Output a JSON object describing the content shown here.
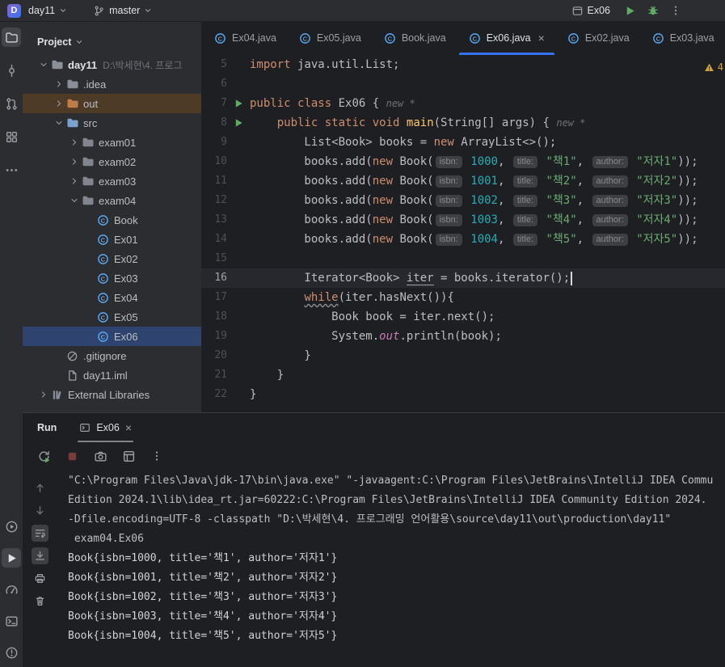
{
  "topbar": {
    "project_badge": "D",
    "project_name": "day11",
    "branch_name": "master",
    "run_config_name": "Ex06"
  },
  "sidebar": {
    "top_icons": [
      {
        "name": "project-icon",
        "active": true
      },
      {
        "name": "commit-icon",
        "active": false
      },
      {
        "name": "pull-requests-icon",
        "active": false
      },
      {
        "name": "structure-icon",
        "active": false
      },
      {
        "name": "more-tools-icon",
        "active": false
      }
    ],
    "bottom_icons": [
      {
        "name": "services-icon",
        "active": false
      },
      {
        "name": "run-icon",
        "active": true
      },
      {
        "name": "profiler-icon",
        "active": false
      },
      {
        "name": "terminal-icon",
        "active": false
      },
      {
        "name": "problems-icon",
        "active": false
      }
    ]
  },
  "project": {
    "header": "Project",
    "tree": [
      {
        "depth": 0,
        "chevron": "down",
        "icon": "folder-icon",
        "label": "day11",
        "bold": true,
        "detail": "D:\\박세현\\4. 프로그"
      },
      {
        "depth": 1,
        "chevron": "right",
        "icon": "folder-icon",
        "label": ".idea"
      },
      {
        "depth": 1,
        "chevron": "right",
        "icon": "folder-excluded-icon",
        "label": "out",
        "highlight": "excluded"
      },
      {
        "depth": 1,
        "chevron": "down",
        "icon": "folder-source-icon",
        "label": "src"
      },
      {
        "depth": 2,
        "chevron": "right",
        "icon": "package-icon",
        "label": "exam01"
      },
      {
        "depth": 2,
        "chevron": "right",
        "icon": "package-icon",
        "label": "exam02"
      },
      {
        "depth": 2,
        "chevron": "right",
        "icon": "package-icon",
        "label": "exam03"
      },
      {
        "depth": 2,
        "chevron": "down",
        "icon": "package-icon",
        "label": "exam04"
      },
      {
        "depth": 3,
        "icon": "class-icon",
        "label": "Book"
      },
      {
        "depth": 3,
        "icon": "class-icon",
        "label": "Ex01"
      },
      {
        "depth": 3,
        "icon": "class-icon",
        "label": "Ex02"
      },
      {
        "depth": 3,
        "icon": "class-icon",
        "label": "Ex03"
      },
      {
        "depth": 3,
        "icon": "class-icon",
        "label": "Ex04"
      },
      {
        "depth": 3,
        "icon": "class-icon",
        "label": "Ex05"
      },
      {
        "depth": 3,
        "icon": "class-icon",
        "label": "Ex06",
        "selected": true
      },
      {
        "depth": 1,
        "icon": "gitignore-icon",
        "label": ".gitignore"
      },
      {
        "depth": 1,
        "icon": "module-file-icon",
        "label": "day11.iml"
      },
      {
        "depth": 0,
        "chevron": "right",
        "icon": "library-icon",
        "label": "External Libraries"
      }
    ]
  },
  "editor": {
    "close_label": "×",
    "inspections": {
      "warnings": "4"
    },
    "tabs": [
      {
        "label": "Ex04.java",
        "icon": "class-icon",
        "active": false
      },
      {
        "label": "Ex05.java",
        "icon": "class-icon",
        "active": false
      },
      {
        "label": "Book.java",
        "icon": "class-icon",
        "active": false
      },
      {
        "label": "Ex06.java",
        "icon": "class-icon",
        "active": true,
        "closable": true
      },
      {
        "label": "Ex02.java",
        "icon": "class-icon",
        "active": false
      },
      {
        "label": "Ex03.java",
        "icon": "class-icon",
        "active": false
      }
    ],
    "lines": [
      {
        "num": "5",
        "segs": [
          [
            "k",
            "import"
          ],
          [
            "p",
            " java.util.List;"
          ]
        ]
      },
      {
        "num": "6",
        "segs": []
      },
      {
        "num": "7",
        "run": true,
        "segs": [
          [
            "k",
            "public"
          ],
          [
            "p",
            " "
          ],
          [
            "k",
            "class"
          ],
          [
            "p",
            " Ex06 { "
          ],
          [
            "vision",
            "new *"
          ]
        ]
      },
      {
        "num": "8",
        "run": true,
        "segs": [
          [
            "p",
            "    "
          ],
          [
            "k",
            "public"
          ],
          [
            "p",
            " "
          ],
          [
            "k",
            "static"
          ],
          [
            "p",
            " "
          ],
          [
            "k",
            "void"
          ],
          [
            "p",
            " "
          ],
          [
            "decl",
            "main"
          ],
          [
            "p",
            "(String[] args) { "
          ],
          [
            "vision",
            "new *"
          ]
        ]
      },
      {
        "num": "9",
        "segs": [
          [
            "p",
            "        List<Book> books = "
          ],
          [
            "k",
            "new"
          ],
          [
            "p",
            " ArrayList<>();"
          ]
        ]
      },
      {
        "num": "10",
        "segs": [
          [
            "p",
            "        books.add("
          ],
          [
            "k",
            "new"
          ],
          [
            "p",
            " Book("
          ],
          [
            "hint",
            "isbn:"
          ],
          [
            "n",
            " 1000"
          ],
          [
            "p",
            ", "
          ],
          [
            "hint",
            "title:"
          ],
          [
            "s",
            " \"책1\""
          ],
          [
            "p",
            ", "
          ],
          [
            "hint",
            "author:"
          ],
          [
            "s",
            " \"저자1\""
          ],
          [
            "p",
            "));"
          ]
        ]
      },
      {
        "num": "11",
        "segs": [
          [
            "p",
            "        books.add("
          ],
          [
            "k",
            "new"
          ],
          [
            "p",
            " Book("
          ],
          [
            "hint",
            "isbn:"
          ],
          [
            "n",
            " 1001"
          ],
          [
            "p",
            ", "
          ],
          [
            "hint",
            "title:"
          ],
          [
            "s",
            " \"책2\""
          ],
          [
            "p",
            ", "
          ],
          [
            "hint",
            "author:"
          ],
          [
            "s",
            " \"저자2\""
          ],
          [
            "p",
            "));"
          ]
        ]
      },
      {
        "num": "12",
        "segs": [
          [
            "p",
            "        books.add("
          ],
          [
            "k",
            "new"
          ],
          [
            "p",
            " Book("
          ],
          [
            "hint",
            "isbn:"
          ],
          [
            "n",
            " 1002"
          ],
          [
            "p",
            ", "
          ],
          [
            "hint",
            "title:"
          ],
          [
            "s",
            " \"책3\""
          ],
          [
            "p",
            ", "
          ],
          [
            "hint",
            "author:"
          ],
          [
            "s",
            " \"저자3\""
          ],
          [
            "p",
            "));"
          ]
        ]
      },
      {
        "num": "13",
        "segs": [
          [
            "p",
            "        books.add("
          ],
          [
            "k",
            "new"
          ],
          [
            "p",
            " Book("
          ],
          [
            "hint",
            "isbn:"
          ],
          [
            "n",
            " 1003"
          ],
          [
            "p",
            ", "
          ],
          [
            "hint",
            "title:"
          ],
          [
            "s",
            " \"책4\""
          ],
          [
            "p",
            ", "
          ],
          [
            "hint",
            "author:"
          ],
          [
            "s",
            " \"저자4\""
          ],
          [
            "p",
            "));"
          ]
        ]
      },
      {
        "num": "14",
        "segs": [
          [
            "p",
            "        books.add("
          ],
          [
            "k",
            "new"
          ],
          [
            "p",
            " Book("
          ],
          [
            "hint",
            "isbn:"
          ],
          [
            "n",
            " 1004"
          ],
          [
            "p",
            ", "
          ],
          [
            "hint",
            "title:"
          ],
          [
            "s",
            " \"책5\""
          ],
          [
            "p",
            ", "
          ],
          [
            "hint",
            "author:"
          ],
          [
            "s",
            " \"저자5\""
          ],
          [
            "p",
            "));"
          ]
        ]
      },
      {
        "num": "15",
        "segs": []
      },
      {
        "num": "16",
        "current": true,
        "caret": true,
        "segs": [
          [
            "p",
            "        Iterator<Book> "
          ],
          [
            "uline",
            "iter"
          ],
          [
            "p",
            " = books.iterator();"
          ]
        ]
      },
      {
        "num": "17",
        "segs": [
          [
            "p",
            "        "
          ],
          [
            "k wavy",
            "while"
          ],
          [
            "p",
            "(iter.hasNext()){"
          ]
        ]
      },
      {
        "num": "18",
        "segs": [
          [
            "p",
            "            Book book = iter.next();"
          ]
        ]
      },
      {
        "num": "19",
        "segs": [
          [
            "p",
            "            System."
          ],
          [
            "field",
            "out"
          ],
          [
            "p",
            ".println(book);"
          ]
        ]
      },
      {
        "num": "20",
        "segs": [
          [
            "p",
            "        }"
          ]
        ]
      },
      {
        "num": "21",
        "segs": [
          [
            "p",
            "    }"
          ]
        ]
      },
      {
        "num": "22",
        "segs": [
          [
            "p",
            "}"
          ]
        ]
      }
    ]
  },
  "run": {
    "title": "Run",
    "tab": {
      "label": "Ex06",
      "icon": "console-icon",
      "close": "×"
    },
    "toolbar_icons": [
      {
        "name": "rerun-icon"
      },
      {
        "name": "stop-icon"
      },
      {
        "name": "thread-dump-icon"
      },
      {
        "name": "restore-layout-icon"
      },
      {
        "name": "more-vertical-icon"
      }
    ],
    "gutter_icons": [
      {
        "name": "arrow-up-icon"
      },
      {
        "name": "arrow-down-icon"
      },
      {
        "name": "soft-wrap-icon",
        "active": true
      },
      {
        "name": "scroll-to-end-icon",
        "active": true
      },
      {
        "name": "print-icon"
      },
      {
        "name": "clear-icon"
      }
    ],
    "console_lines": [
      {
        "cls": "cmd",
        "text": "\"C:\\Program Files\\Java\\jdk-17\\bin\\java.exe\" \"-javaagent:C:\\Program Files\\JetBrains\\IntelliJ IDEA Commu"
      },
      {
        "cls": "cmd",
        "text": "Edition 2024.1\\lib\\idea_rt.jar=60222:C:\\Program Files\\JetBrains\\IntelliJ IDEA Community Edition 2024."
      },
      {
        "cls": "cmd",
        "text": "-Dfile.encoding=UTF-8 -classpath \"D:\\박세현\\4. 프로그래밍 언어활용\\source\\day11\\out\\production\\day11\""
      },
      {
        "cls": "cmd",
        "text": " exam04.Ex06"
      },
      {
        "cls": "out",
        "text": "Book{isbn=1000, title='책1', author='저자1'}"
      },
      {
        "cls": "out",
        "text": "Book{isbn=1001, title='책2', author='저자2'}"
      },
      {
        "cls": "out",
        "text": "Book{isbn=1002, title='책3', author='저자3'}"
      },
      {
        "cls": "out",
        "text": "Book{isbn=1003, title='책4', author='저자4'}"
      },
      {
        "cls": "out",
        "text": "Book{isbn=1004, title='책5', author='저자5'}"
      }
    ],
    "colors": {
      "accent": "#3574f0",
      "run_green": "#5fad65",
      "stop_red": "#c75450",
      "selection": "#2e436e",
      "warning": "#d9a343"
    }
  }
}
